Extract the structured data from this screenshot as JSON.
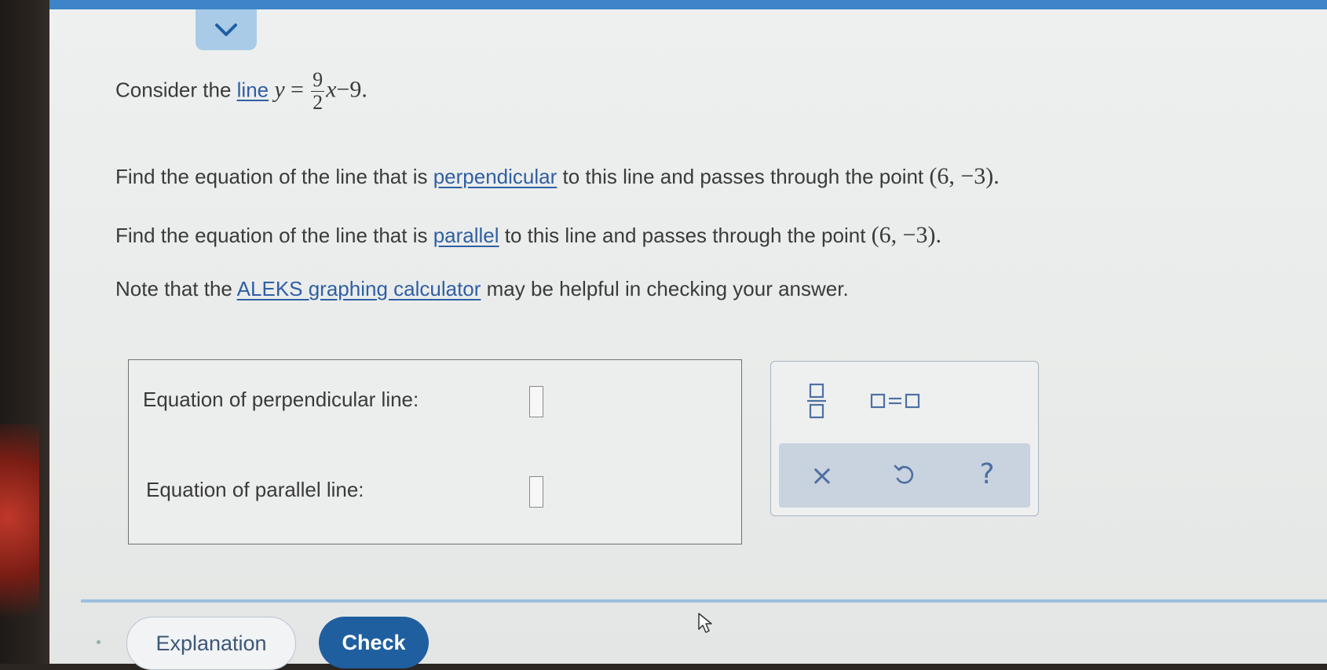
{
  "question": {
    "line1": {
      "prefix": "Consider the ",
      "link": "line",
      "eq_lhs": "y",
      "eq_sign": "=",
      "frac_num": "9",
      "frac_den": "2",
      "eq_var": "x",
      "eq_rest": "−9."
    },
    "line2": {
      "prefix": "Find the equation of the line that is ",
      "link": "perpendicular",
      "suffix": " to this line and passes through the point ",
      "point": "(6,  −3)."
    },
    "line3": {
      "prefix": "Find the equation of the line that is ",
      "link": "parallel",
      "suffix": " to this line and passes through the point ",
      "point": "(6,  −3)."
    },
    "line4": {
      "prefix": "Note that the ",
      "link": "ALEKS graphing calculator",
      "suffix": " may be helpful in checking your answer."
    }
  },
  "answers": {
    "perpendicular_label": "Equation of perpendicular line:",
    "perpendicular_value": "",
    "parallel_label": "Equation of parallel line:",
    "parallel_value": ""
  },
  "palette": {
    "fraction_icon": "fraction-template-icon",
    "equation_icon": "equation-template-icon",
    "clear_symbol": "×",
    "undo_icon": "undo-icon",
    "help_symbol": "?"
  },
  "footer": {
    "explanation_label": "Explanation",
    "check_label": "Check"
  },
  "colors": {
    "link": "#2f5fa3",
    "topbar": "#3d85c8",
    "check_button": "#1f5fa0",
    "palette_symbol": "#4f6fa0"
  }
}
